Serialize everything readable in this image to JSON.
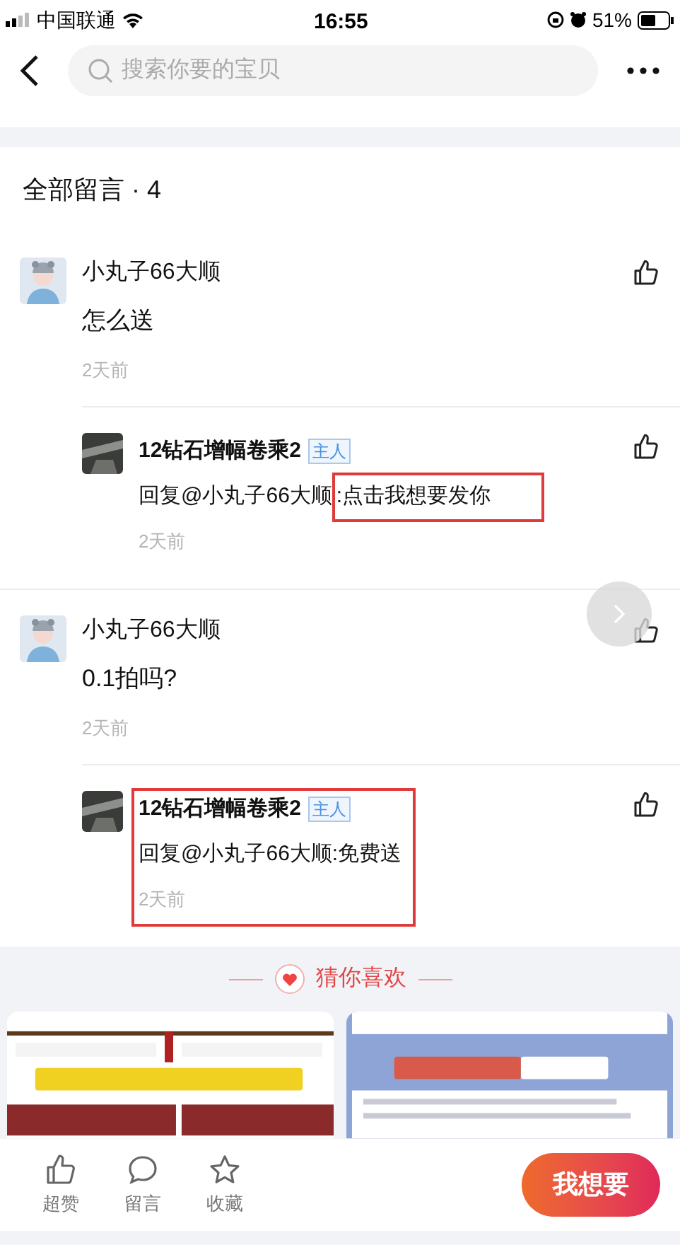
{
  "status_bar": {
    "carrier": "中国联通",
    "time": "16:55",
    "battery": "51%"
  },
  "search": {
    "placeholder": "搜索你要的宝贝"
  },
  "comments_header": {
    "title": "全部留言 · 4"
  },
  "comments": [
    {
      "author": "小丸子66大顺",
      "text": "怎么送",
      "time": "2天前",
      "reply": {
        "author": "12钻石增幅卷乘2",
        "badge": "主人",
        "text": "回复@小丸子66大顺",
        "marked": ":点击我想要发你",
        "time": "2天前",
        "boxed": false
      }
    },
    {
      "author": "小丸子66大顺",
      "text": "0.1拍吗?",
      "time": "2天前",
      "reply": {
        "author": "12钻石增幅卷乘2",
        "badge": "主人",
        "text": "回复@小丸子66大顺:免费送",
        "time": "2天前",
        "boxed": true
      }
    }
  ],
  "recommend": {
    "title": "猜你喜欢"
  },
  "bottom_bar": {
    "actions": [
      {
        "kind": "like",
        "label": "超赞"
      },
      {
        "kind": "comment",
        "label": "留言"
      },
      {
        "kind": "favorite",
        "label": "收藏"
      }
    ],
    "button": "我想要"
  }
}
